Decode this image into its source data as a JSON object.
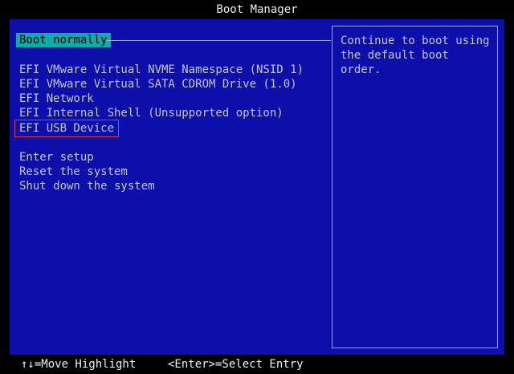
{
  "window": {
    "title": "Boot Manager"
  },
  "menu": {
    "selected": "Boot normally",
    "items": [
      "EFI VMware Virtual NVME Namespace (NSID 1)",
      "EFI VMware Virtual SATA CDROM Drive (1.0)",
      "EFI Network",
      "EFI Internal Shell (Unsupported option)",
      "EFI USB Device"
    ],
    "actions": [
      "Enter setup",
      "Reset the system",
      "Shut down the system"
    ],
    "highlighted_item": "EFI USB Device"
  },
  "info": {
    "text": "Continue to boot using\nthe default boot order."
  },
  "footer": {
    "move_hint": "↑↓=Move Highlight",
    "select_hint": "<Enter>=Select Entry"
  },
  "colors": {
    "panel": "#0d0faa",
    "selection": "#12aaa8",
    "outline": "#e03a3a"
  }
}
